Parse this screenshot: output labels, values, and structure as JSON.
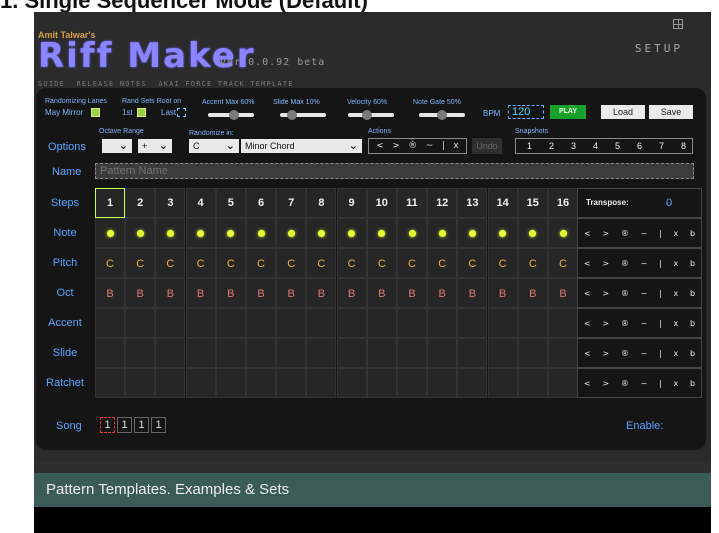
{
  "page_heading": "1. Single Sequencer Mode (Default)",
  "brand": {
    "author": "Amit Talwar's",
    "title": "Riff Maker",
    "version": "ver 0.0.92 beta",
    "links": [
      "GUIDE",
      "RELEASE NOTES",
      "AKAI FORCE TRACK TEMPLATE"
    ]
  },
  "setup_label": "SETUP",
  "controls": {
    "randomizing_lanes_label": "Randomizing Lanes",
    "may_mirror_label": "May Mirror",
    "rand_sets_root_label": "Rand Sets Root on",
    "first_label": "1st",
    "last_label": "Last",
    "accent_max_label": "Accent Max 60%",
    "slide_max_label": "Slide Max 10%",
    "velocity_label": "Velocity 60%",
    "note_gate_label": "Note Gate 50%",
    "accent_max": 0.6,
    "slide_max": 0.1,
    "velocity": 0.6,
    "note_gate": 0.5,
    "bpm_label": "BPM",
    "bpm_value": "120",
    "play_label": "PLAY",
    "load_label": "Load",
    "save_label": "Save"
  },
  "options": {
    "label": "Options",
    "octave_range_label": "Octave Range",
    "octave_dd1": "",
    "octave_dd2": "+",
    "randomize_in_label": "Randomize in:",
    "root_value": "C",
    "scale_value": "Minor Chord",
    "actions_label": "Actions",
    "actions": [
      "<",
      ">",
      "®",
      "~",
      "|",
      "x"
    ],
    "undo_label": "Undo",
    "snapshots_label": "Snapshots",
    "snapshots": [
      "1",
      "2",
      "3",
      "4",
      "5",
      "6",
      "7",
      "8"
    ]
  },
  "name_row": {
    "label": "Name",
    "placeholder": "Pattern Name"
  },
  "grid": {
    "steps_label": "Steps",
    "note_label": "Note",
    "pitch_label": "Pitch",
    "oct_label": "Oct",
    "accent_label": "Accent",
    "slide_label": "Slide",
    "ratchet_label": "Ratchet",
    "steps": [
      "1",
      "2",
      "3",
      "4",
      "5",
      "6",
      "7",
      "8",
      "9",
      "10",
      "11",
      "12",
      "13",
      "14",
      "15",
      "16"
    ],
    "pitch": [
      "C",
      "C",
      "C",
      "C",
      "C",
      "C",
      "C",
      "C",
      "C",
      "C",
      "C",
      "C",
      "C",
      "C",
      "C",
      "C"
    ],
    "oct": [
      "B",
      "B",
      "B",
      "B",
      "B",
      "B",
      "B",
      "B",
      "B",
      "B",
      "B",
      "B",
      "B",
      "B",
      "B",
      "B"
    ],
    "transpose_label": "Transpose:",
    "transpose_value": "0",
    "lane_actions": [
      "<",
      ">",
      "®",
      "~",
      "|",
      "x",
      "b"
    ]
  },
  "song": {
    "label": "Song",
    "slots": [
      "1",
      "1",
      "1",
      "1"
    ],
    "enable_label": "Enable:"
  },
  "bottom_bar": "Pattern Templates. Examples & Sets"
}
